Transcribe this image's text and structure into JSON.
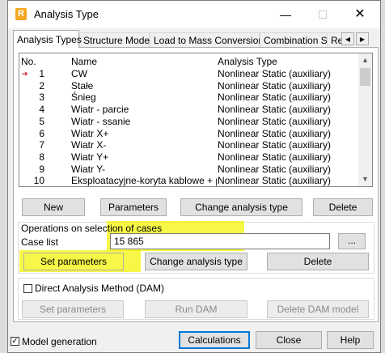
{
  "window": {
    "title": "Analysis Type",
    "minimize": "—",
    "maximize": "☐",
    "close": "✕"
  },
  "tabs": [
    {
      "label": "Analysis Types",
      "active": true
    },
    {
      "label": "Structure Model"
    },
    {
      "label": "Load to Mass Conversion"
    },
    {
      "label": "Combination Sign"
    },
    {
      "label": "Res"
    }
  ],
  "tab_arrows": {
    "left": "◀",
    "right": "▶"
  },
  "list": {
    "headers": {
      "no": "No.",
      "name": "Name",
      "type": "Analysis Type"
    },
    "rows": [
      {
        "no": "1",
        "name": "CW",
        "type": "Nonlinear Static (auxiliary)",
        "current": true
      },
      {
        "no": "2",
        "name": "Stałe",
        "type": "Nonlinear Static (auxiliary)"
      },
      {
        "no": "3",
        "name": "Śnieg",
        "type": "Nonlinear Static (auxiliary)"
      },
      {
        "no": "4",
        "name": "Wiatr - parcie",
        "type": "Nonlinear Static (auxiliary)"
      },
      {
        "no": "5",
        "name": "Wiatr - ssanie",
        "type": "Nonlinear Static (auxiliary)"
      },
      {
        "no": "6",
        "name": "Wiatr X+",
        "type": "Nonlinear Static (auxiliary)"
      },
      {
        "no": "7",
        "name": "Wiatr X-",
        "type": "Nonlinear Static (auxiliary)"
      },
      {
        "no": "8",
        "name": "Wiatr Y+",
        "type": "Nonlinear Static (auxiliary)"
      },
      {
        "no": "9",
        "name": "Wiatr Y-",
        "type": "Nonlinear Static (auxiliary)"
      },
      {
        "no": "10",
        "name": "Eksploatacyjne-koryta kablowe + p...",
        "type": "Nonlinear Static (auxiliary)"
      }
    ],
    "current_marker": "➔",
    "scroll_up": "▲",
    "scroll_down": "▼"
  },
  "list_buttons": {
    "new": "New",
    "parameters": "Parameters",
    "change_type": "Change analysis type",
    "delete": "Delete"
  },
  "operations": {
    "title": "Operations on selection of cases",
    "case_list_label": "Case list",
    "case_list_value": "15 865",
    "browse": "...",
    "set_parameters": "Set parameters",
    "change_type": "Change analysis type",
    "delete": "Delete"
  },
  "dam": {
    "checkbox_label": "Direct Analysis Method (DAM)",
    "checked": false,
    "set_parameters": "Set parameters",
    "run": "Run DAM",
    "delete": "Delete DAM model"
  },
  "footer": {
    "model_generation_label": "Model generation",
    "model_generation_checked": true,
    "checkmark": "✓",
    "calculations": "Calculations",
    "close": "Close",
    "help": "Help"
  },
  "colors": {
    "highlight": "#f5f514",
    "accent": "#0078d7",
    "marker": "#d01010",
    "app_icon": "#f5a623"
  }
}
